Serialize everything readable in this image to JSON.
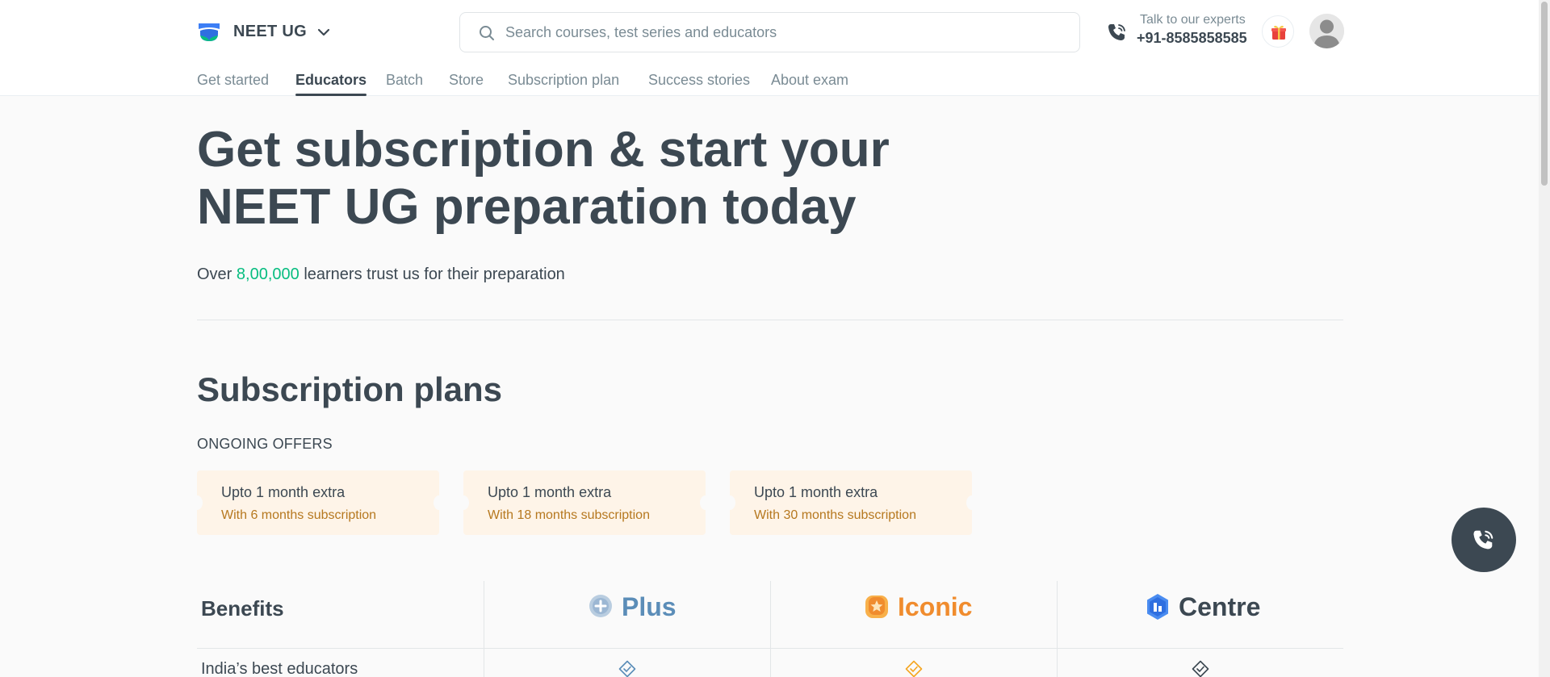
{
  "header": {
    "goal": "NEET UG",
    "search_placeholder": "Search courses, test series and educators",
    "talk_label": "Talk to our experts",
    "phone": "+91-8585858585"
  },
  "nav": {
    "items": [
      "Get started",
      "Educators",
      "Batch",
      "Store",
      "Subscription plan",
      "Success stories",
      "About exam"
    ],
    "active": "Educators"
  },
  "hero": {
    "title_line1": "Get subscription & start your",
    "title_line2": "NEET UG preparation today",
    "learners_prefix": "Over ",
    "learners_count": "8,00,000",
    "learners_suffix": " learners trust us for their preparation"
  },
  "plans": {
    "title": "Subscription plans",
    "offers_label": "ONGOING OFFERS",
    "offers": [
      {
        "title": "Upto 1 month extra",
        "subtitle": "With 6 months subscription"
      },
      {
        "title": "Upto 1 month extra",
        "subtitle": "With 18 months subscription"
      },
      {
        "title": "Upto 1 month extra",
        "subtitle": "With 30 months subscription"
      }
    ]
  },
  "benefits_table": {
    "header": "Benefits",
    "plans": [
      {
        "name": "Plus",
        "color": "#5b8db8",
        "icon": "plus-badge-icon"
      },
      {
        "name": "Iconic",
        "color": "#f08c2e",
        "icon": "star-badge-icon"
      },
      {
        "name": "Centre",
        "color": "#3c4852",
        "icon": "centre-badge-icon"
      }
    ],
    "rows": [
      {
        "label": "India’s best educators",
        "checks": [
          "#5b8db8",
          "#f5a623",
          "#3c4852"
        ]
      }
    ]
  },
  "colors": {
    "text": "#3c4852",
    "muted": "#7a8b94",
    "accent_green": "#08bd80",
    "offer_bg": "#fef4e8",
    "offer_sub": "#b6781f"
  }
}
